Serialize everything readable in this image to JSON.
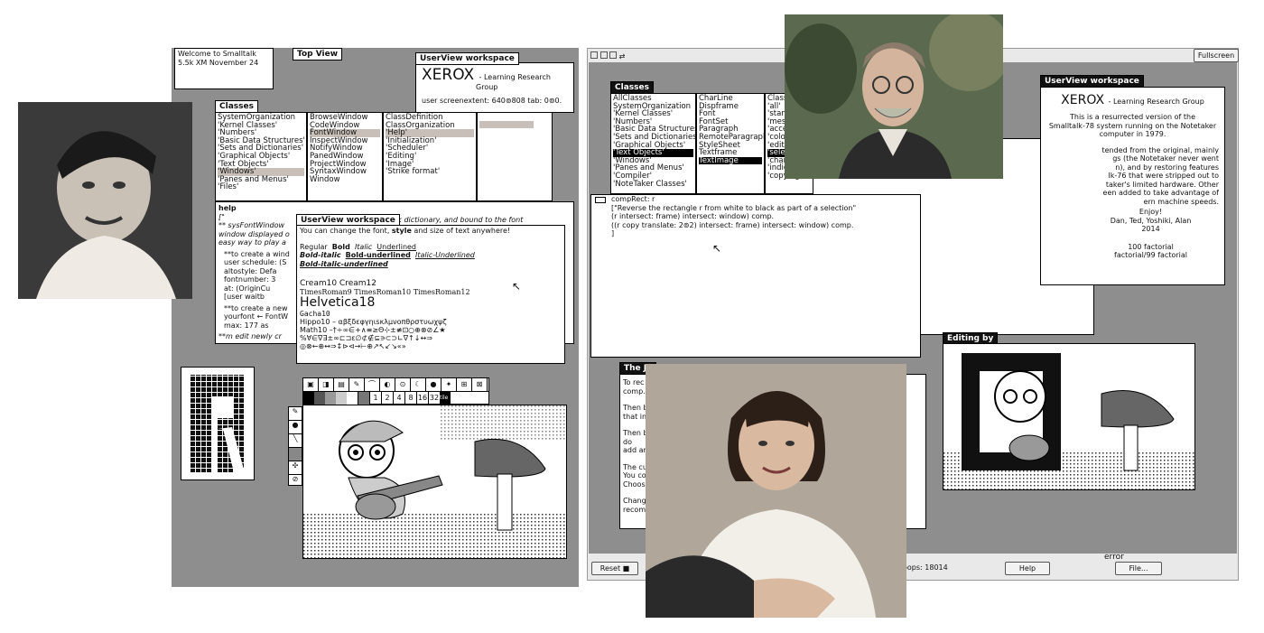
{
  "left_screen": {
    "welcome": [
      "Welcome to Smalltalk",
      "5.5k XM November 24"
    ],
    "top_view_title": "Top View",
    "userview_workspace_title": "UserView workspace",
    "xerox": "XEROX",
    "xerox_sub": "- Learning Research",
    "xerox_group": "Group",
    "screen_extent": "user screenextent: 640⊚808 tab: 0⊚0.",
    "classes_title": "Classes",
    "classes_list": [
      "SystemOrganization",
      "'Kernel Classes'",
      "'Numbers'",
      "'Basic Data Structures'",
      "'Sets and Dictionaries'",
      "'Graphical Objects'",
      "'Text Objects'",
      "'Windows'",
      "'Panes and Menus'",
      "'Files'"
    ],
    "classes_selected": "'Windows'",
    "window_classes": [
      "BrowseWindow",
      "CodeWindow",
      "FontWindow",
      "InspectWindow",
      "NotifyWindow",
      "PanedWindow",
      "ProjectWindow",
      "SyntaxWindow",
      "Window"
    ],
    "window_selected": "FontWindow",
    "categories": [
      "ClassDefinition",
      "ClassOrganization",
      "'Help'",
      "'Initialization'",
      "'Scheduler'",
      "'Editing'",
      "'Image'",
      "'Strike format'"
    ],
    "categories_selected": "'Help'",
    "help_label": "help",
    "help_lines": [
      "[\"",
      "** sysFontWindow",
      "window displayed o",
      "easy way to play a"
    ],
    "help_lines2": [
      "**to create a wind",
      "user schedule: (S",
      "altostyle: Defa",
      "fontnumber: 3",
      "at: (OriginCu",
      "[user waitb"
    ],
    "help_lines3": [
      "**to create a new",
      "yourfont ← FontW",
      "max: 177 as"
    ],
    "help_lines4": [
      "**m edit newly cr"
    ],
    "help_right": [
      "talk dictionary, and bound to the font",
      "so, you can change the font, style and size of text anywhere!"
    ],
    "font_ws_title": "UserView workspace",
    "font_intro_a": "You can change the font, ",
    "font_intro_b": "style",
    "font_intro_c": " and size of text anywhere!",
    "font_styles": [
      "Regular",
      "Bold",
      "Italic",
      "Underlined",
      "Bold-italic",
      "Bold-underlined",
      "Italic-Underlined",
      "Bold-italic-underlined"
    ],
    "font_samples": [
      "Cream10  Cream12",
      "TimesRoman9  TimesRoman10  TimesRoman12",
      "Helvetica18",
      "Gacha10",
      "Hippo10 – αβξδεφγηιsκλμνοπθρστυωχψζ",
      "Math10 –†÷∞∈+∧≡≥Θ⊹±≢⊡○⊕⊗⊘∠★",
      "%∀∈∇∃±∞⊏⊐ε∅⊄∉⊆∍⊂⊃∟∇↑↓↔⇒",
      "◎⊗←⊕↔⇒↕⊳⊲→⊢⊕↗↖↙↘«»"
    ],
    "paint_sizes": [
      "1",
      "2",
      "4",
      "8",
      "16",
      "32"
    ],
    "paint_mode": "tile"
  },
  "right_screen": {
    "fullscreen": "Fullscreen",
    "classes_title": "Classes",
    "classes_list": [
      "AllClasses",
      "SystemOrganization",
      "'Kernel Classes'",
      "'Numbers'",
      "'Basic Data Structures'",
      "'Sets and Dictionaries'",
      "'Graphical Objects'",
      "'Text Objects'",
      "'Windows'",
      "'Panes and Menus'",
      "'Compiler'",
      "'NoteTaker Classes'"
    ],
    "classes_selected": "'Text Objects'",
    "text_classes": [
      "CharLine",
      "Dispframe",
      "Font",
      "FontSet",
      "Paragraph",
      "RemoteParagraph",
      "StyleSheet",
      "Textframe",
      "TextImage"
    ],
    "text_selected": "TextImage",
    "categories": [
      "Class",
      "'all'",
      "'stan",
      "'mes",
      "'acce",
      "'colo",
      "'edit",
      "'sele",
      "'char",
      "'indicating'",
      "'copying'"
    ],
    "categories_selected": "'sele",
    "code": [
      "compRect: r",
      "  [\"Reverse the rectangle r from white to black as part of a selection\"",
      "  (r intersect: frame) intersect: window) comp.",
      "  ((r copy translate: 2⊚2) intersect: frame) intersect: window) comp.",
      "  ]"
    ],
    "userview_title": "UserView workspace",
    "xerox": "XEROX",
    "xerox_sub": "- Learning Research Group",
    "about": [
      "This is a resurrected version of the",
      "Smalltalk-78 system running on the Notetaker",
      "computer in 1979."
    ],
    "about2": [
      "tended from the original, mainly",
      "gs (the Notetaker never went",
      "n), and by restoring features",
      "lk-76 that were stripped out to",
      "taker's limited hardware.  Other",
      "een added to take advantage of",
      "ern machine speeds."
    ],
    "enjoy": "Enjoy!",
    "authors": "Dan, Ted, Yoshiki, Alan",
    "year": "2014",
    "factorial": [
      "100 factorial",
      "factorial/99 factorial"
    ],
    "editing_label": "Editing by",
    "journal_title": "The Jo",
    "journal_lines": [
      "To rec",
      "comp.",
      "",
      "Then b",
      "that in",
      "",
      "Then b",
      "do",
      "add ar",
      "",
      "The cu",
      "You co",
      "Choose",
      "",
      "Chang",
      "recom"
    ],
    "reset": "Reset",
    "help": "Help",
    "file": "File...",
    "loops": "oops: 18014",
    "error": "error"
  }
}
